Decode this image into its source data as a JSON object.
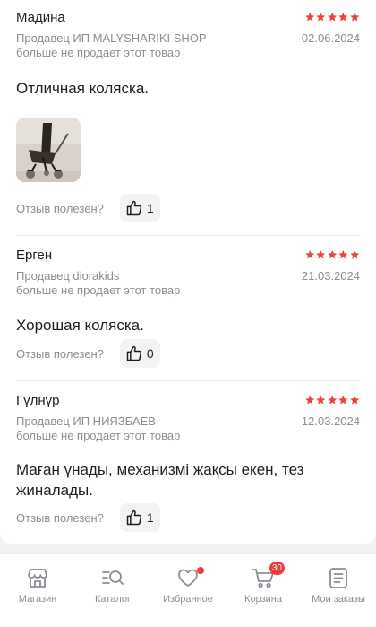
{
  "reviews": [
    {
      "author": "Мадина",
      "rating": 5,
      "seller": "Продавец ИП MALYSHARIKI SHOP",
      "date": "02.06.2024",
      "status": "больше не продает этот товар",
      "text": "Отличная коляска.",
      "helpful_label": "Отзыв полезен?",
      "likes": "1"
    },
    {
      "author": "Ерген",
      "rating": 5,
      "seller": "Продавец diorakids",
      "date": "21.03.2024",
      "status": "больше не продает этот товар",
      "text": "Хорошая коляска.",
      "helpful_label": "Отзыв полезен?",
      "likes": "0"
    },
    {
      "author": "Гүлнұр",
      "rating": 5,
      "seller": "Продавец ИП НИЯЗБАЕВ",
      "date": "12.03.2024",
      "status": "больше не продает этот товар",
      "text": "Маған ұнады, механизмі жақсы екен, тез жиналады.",
      "helpful_label": "Отзыв полезен?",
      "likes": "1"
    }
  ],
  "tabbar": {
    "items": [
      {
        "label": "Магазин",
        "icon": "store-icon"
      },
      {
        "label": "Каталог",
        "icon": "catalog-search-icon"
      },
      {
        "label": "Избранное",
        "icon": "heart-icon"
      },
      {
        "label": "Корзина",
        "icon": "cart-icon",
        "badge": "30"
      },
      {
        "label": "Мои заказы",
        "icon": "orders-icon"
      }
    ]
  },
  "colors": {
    "star": "#e8453c",
    "badge": "#f03b3b",
    "muted_text": "#8d8d96"
  }
}
